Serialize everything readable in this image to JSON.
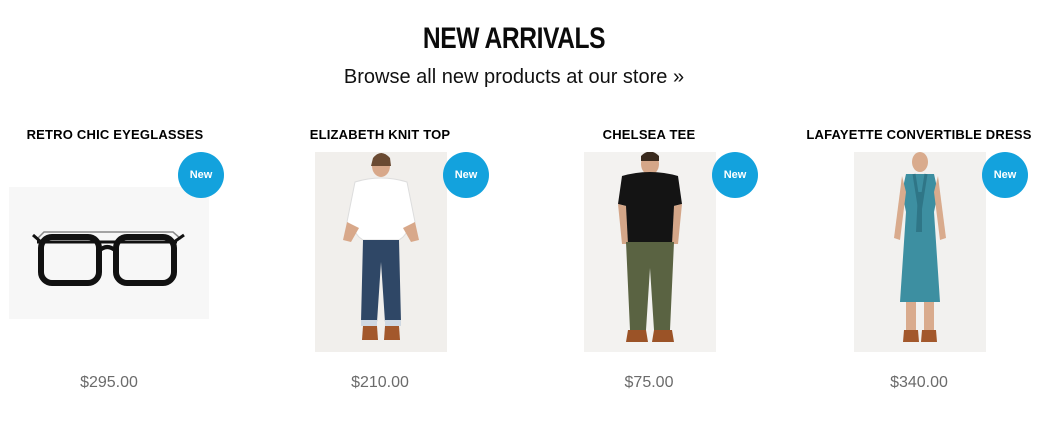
{
  "section": {
    "title": "NEW ARRIVALS",
    "subtitle": "Browse all new products at our store »"
  },
  "products": [
    {
      "name": "RETRO CHIC EYEGLASSES",
      "badge": "New",
      "price": "$295.00",
      "image": "eyeglasses-image"
    },
    {
      "name": "ELIZABETH KNIT TOP",
      "badge": "New",
      "price": "$210.00",
      "image": "knit-top-image"
    },
    {
      "name": "CHELSEA TEE",
      "badge": "New",
      "price": "$75.00",
      "image": "tee-image"
    },
    {
      "name": "LAFAYETTE CONVERTIBLE DRESS",
      "badge": "New",
      "price": "$340.00",
      "image": "dress-image"
    }
  ],
  "colors": {
    "badge": "#13a2dd",
    "price": "#6b6b6b"
  }
}
